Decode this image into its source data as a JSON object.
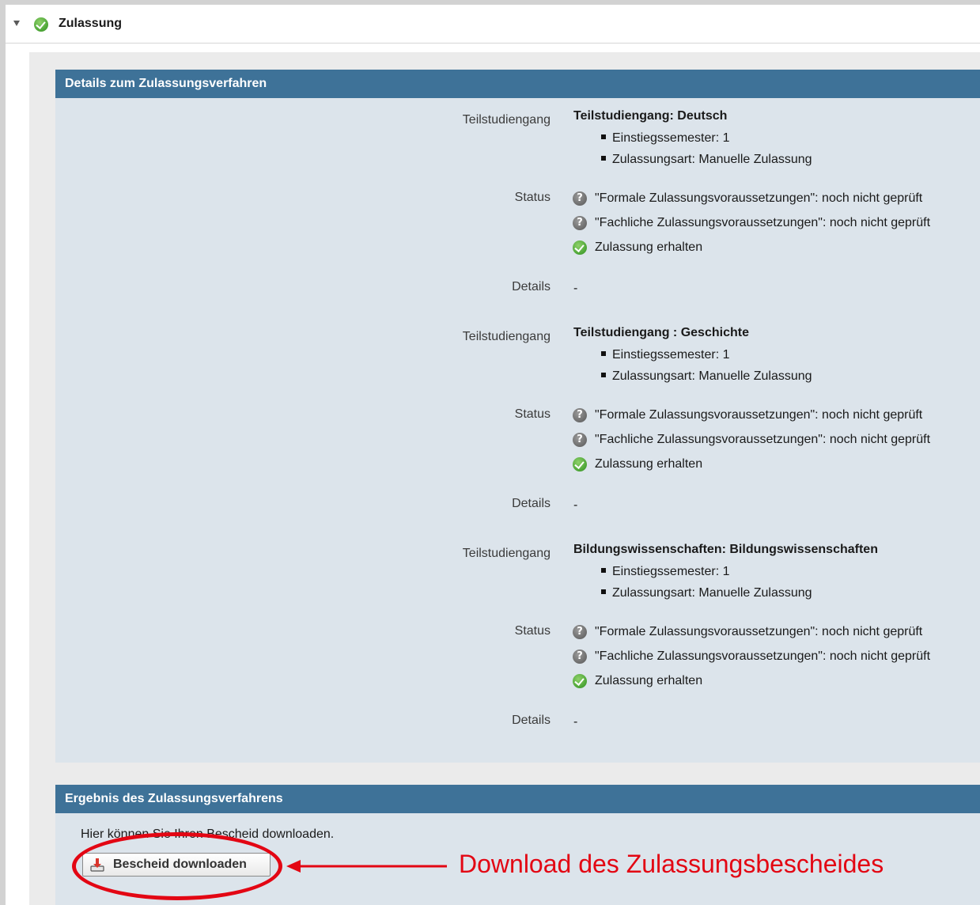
{
  "header": {
    "title": "Zulassung",
    "status_icon": "check-circle-icon"
  },
  "details_panel": {
    "title": "Details zum Zulassungsverfahren",
    "blocks": [
      {
        "label_program": "Teilstudiengang",
        "program": "Teilstudiengang: Deutsch",
        "bullets": [
          "Einstiegssemester: 1",
          "Zulassungsart: Manuelle Zulassung"
        ],
        "label_status": "Status",
        "statuses": [
          {
            "icon": "question-icon",
            "text": "\"Formale Zulassungsvoraussetzungen\": noch nicht geprüft"
          },
          {
            "icon": "question-icon",
            "text": "\"Fachliche Zulassungsvoraussetzungen\": noch nicht geprüft"
          },
          {
            "icon": "check-circle-icon",
            "text": "Zulassung erhalten"
          }
        ],
        "label_details": "Details",
        "details": "-"
      },
      {
        "label_program": "Teilstudiengang",
        "program": "Teilstudiengang : Geschichte",
        "bullets": [
          "Einstiegssemester: 1",
          "Zulassungsart: Manuelle Zulassung"
        ],
        "label_status": "Status",
        "statuses": [
          {
            "icon": "question-icon",
            "text": "\"Formale Zulassungsvoraussetzungen\": noch nicht geprüft"
          },
          {
            "icon": "question-icon",
            "text": "\"Fachliche Zulassungsvoraussetzungen\": noch nicht geprüft"
          },
          {
            "icon": "check-circle-icon",
            "text": "Zulassung erhalten"
          }
        ],
        "label_details": "Details",
        "details": "-"
      },
      {
        "label_program": "Teilstudiengang",
        "program": "Bildungswissenschaften: Bildungswissenschaften",
        "bullets": [
          "Einstiegssemester: 1",
          "Zulassungsart: Manuelle Zulassung"
        ],
        "label_status": "Status",
        "statuses": [
          {
            "icon": "question-icon",
            "text": "\"Formale Zulassungsvoraussetzungen\": noch nicht geprüft"
          },
          {
            "icon": "question-icon",
            "text": "\"Fachliche Zulassungsvoraussetzungen\": noch nicht geprüft"
          },
          {
            "icon": "check-circle-icon",
            "text": "Zulassung erhalten"
          }
        ],
        "label_details": "Details",
        "details": "-"
      }
    ]
  },
  "result_panel": {
    "title": "Ergebnis des Zulassungsverfahrens",
    "text": "Hier können Sie Ihren Bescheid downloaden.",
    "button_label": "Bescheid downloaden",
    "button_icon": "download-icon"
  },
  "annotation": {
    "text": "Download des Zulassungsbescheides",
    "color": "#e30613"
  },
  "colors": {
    "panel_header": "#3e7298",
    "panel_body": "#dce4eb"
  }
}
